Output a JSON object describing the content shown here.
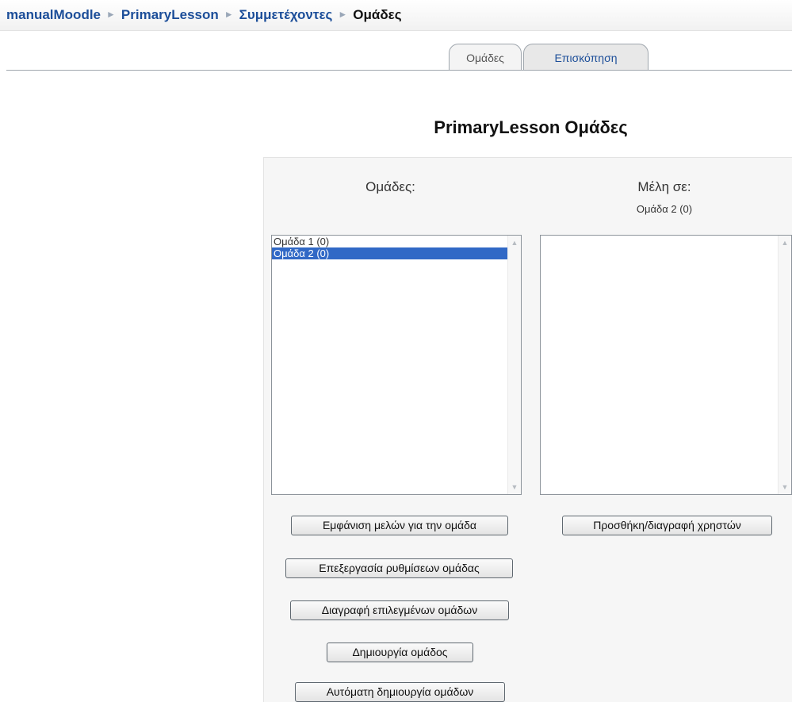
{
  "breadcrumb": {
    "items": [
      "manualMoodle",
      "PrimaryLesson",
      "Συμμετέχοντες",
      "Ομάδες"
    ],
    "separator": "►"
  },
  "tabs": [
    {
      "label": "Ομάδες",
      "active": true
    },
    {
      "label": "Επισκόπηση",
      "active": false
    }
  ],
  "page_title": "PrimaryLesson Ομάδες",
  "groups": {
    "heading": "Ομάδες:",
    "items": [
      "Ομάδα 1 (0)",
      "Ομάδα 2 (0)"
    ],
    "selected_index": 1
  },
  "members": {
    "heading": "Μέλη σε:",
    "subheading": "Ομάδα 2 (0)",
    "items": []
  },
  "buttons": {
    "show_members": "Εμφάνιση μελών για την ομάδα",
    "edit_settings": "Επεξεργασία ρυθμίσεων ομάδας",
    "delete_selected": "Διαγραφή επιλεγμένων ομάδων",
    "create_group": "Δημιουργία ομάδος",
    "auto_create": "Αυτόματη δημιουργία ομάδων",
    "add_remove_users": "Προσθήκη/διαγραφή χρηστών"
  },
  "colors": {
    "link": "#1c4e99",
    "selection": "#3169c6"
  }
}
